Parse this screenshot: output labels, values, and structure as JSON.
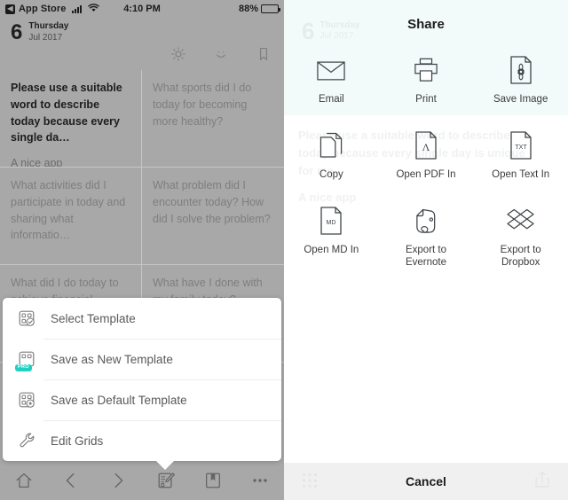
{
  "status_bar": {
    "back_label": "App Store",
    "back_icon": "chevron-left-icon",
    "signal_icon": "cellular-signal-icon",
    "wifi_icon": "wifi-icon",
    "time": "4:10 PM",
    "battery_percent": "88%",
    "battery_icon": "battery-icon"
  },
  "date_header": {
    "day_number": "6",
    "weekday": "Thursday",
    "month_year": "Jul 2017"
  },
  "top_icons": [
    {
      "name": "brightness-icon",
      "label": "Brightness"
    },
    {
      "name": "mood-icon",
      "label": "Mood"
    },
    {
      "name": "bookmark-icon",
      "label": "Bookmark"
    }
  ],
  "journal_grid": {
    "cells": [
      {
        "question": "Please use a suitable word to describe today because every single da…",
        "answer": "A nice app",
        "filled": true
      },
      {
        "question": "What sports did I do today for becoming more healthy?",
        "answer": "",
        "filled": false
      },
      {
        "question": "What activities did I participate in today and sharing what informatio…",
        "answer": "",
        "filled": false
      },
      {
        "question": "What problem did I encounter today? How did I solve the problem?",
        "answer": "",
        "filled": false
      },
      {
        "question": "What did I do today to achieve financial",
        "answer": "",
        "filled": false
      },
      {
        "question": "What have I done with my family today?",
        "answer": "",
        "filled": false
      }
    ]
  },
  "template_menu": {
    "items": [
      {
        "label": "Select Template",
        "icon": "template-check-icon",
        "badge": ""
      },
      {
        "label": "Save as New Template",
        "icon": "template-new-icon",
        "badge": "PRO"
      },
      {
        "label": "Save as Default Template",
        "icon": "template-default-icon",
        "badge": ""
      },
      {
        "label": "Edit Grids",
        "icon": "wrench-icon",
        "badge": ""
      }
    ]
  },
  "bottom_toolbar": {
    "items": [
      {
        "name": "home-icon",
        "label": "Home"
      },
      {
        "name": "chevron-left-icon",
        "label": "Previous"
      },
      {
        "name": "chevron-right-icon",
        "label": "Next"
      },
      {
        "name": "template-edit-icon",
        "label": "Template"
      },
      {
        "name": "bookmark-book-icon",
        "label": "Bookmarks"
      },
      {
        "name": "more-icon",
        "label": "More"
      }
    ]
  },
  "share_sheet": {
    "title": "Share",
    "rows": [
      [
        {
          "label": "Email",
          "icon": "envelope-icon"
        },
        {
          "label": "Print",
          "icon": "printer-icon"
        },
        {
          "label": "Save Image",
          "icon": "image-file-icon"
        }
      ],
      [
        {
          "label": "Copy",
          "icon": "copy-icon"
        },
        {
          "label": "Open PDF In",
          "icon": "pdf-file-icon"
        },
        {
          "label": "Open Text In",
          "icon": "txt-file-icon"
        }
      ],
      [
        {
          "label": "Open MD In",
          "icon": "md-file-icon"
        },
        {
          "label": "Export to Evernote",
          "icon": "evernote-icon"
        },
        {
          "label": "Export to Dropbox",
          "icon": "dropbox-icon"
        }
      ]
    ],
    "cancel_label": "Cancel",
    "ghost": {
      "day_number": "6",
      "weekday": "Thursday",
      "month_year": "Jul 2017",
      "body_line1": "Please use a suitable word to describe",
      "body_line2": "today because every single day is unique",
      "body_line3": "for me.",
      "answer": "A nice app"
    }
  },
  "colors": {
    "dim_background": "#a8a8a8",
    "share_top_background": "#f3fafa",
    "pro_badge": "#1fd0c3",
    "cancel_bar": "#f0f0f0",
    "text_primary": "#1c1c1c",
    "text_secondary": "#7e7e7e"
  }
}
